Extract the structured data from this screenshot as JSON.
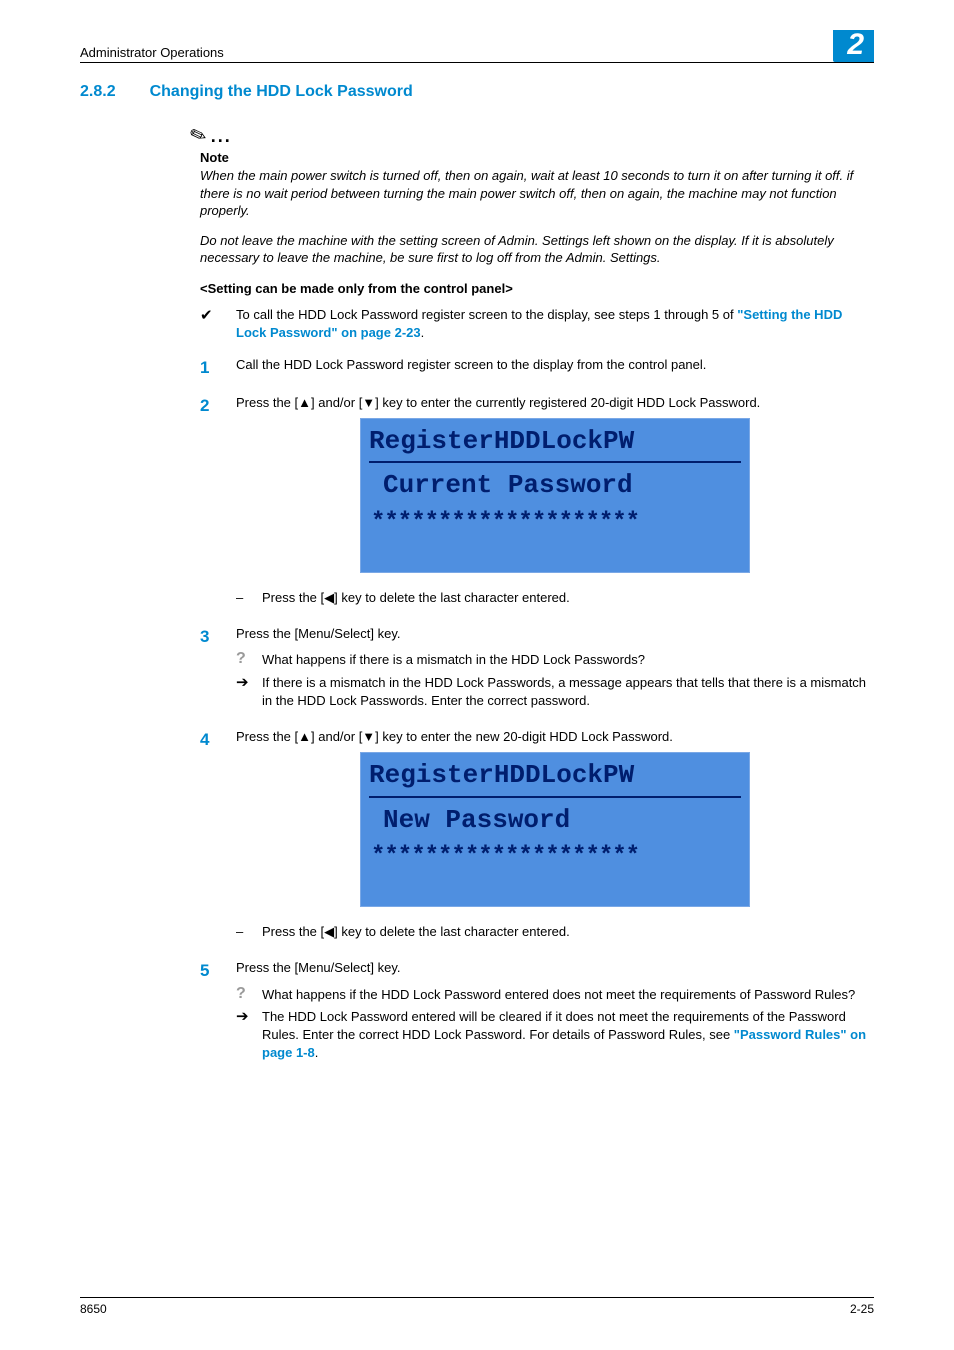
{
  "header": {
    "title": "Administrator Operations",
    "chapter": "2"
  },
  "section": {
    "number": "2.8.2",
    "title": "Changing the HDD Lock Password"
  },
  "note": {
    "label": "Note",
    "para1": "When the main power switch is turned off, then on again, wait at least 10 seconds to turn it on after turning it off. if there is no wait period between turning the main power switch off, then on again, the machine may not function properly.",
    "para2": "Do not leave the machine with the setting screen of Admin. Settings left shown on the display. If it is absolutely necessary to leave the machine, be sure first to log off from the Admin. Settings."
  },
  "subhead": "<Setting can be made only from the control panel>",
  "prereq": {
    "text_before": "To call the HDD Lock Password register screen to the display, see steps 1 through 5 of ",
    "link": "\"Setting the HDD Lock Password\" on page 2-23",
    "text_after": "."
  },
  "steps": {
    "s1": {
      "num": "1",
      "text": "Call the HDD Lock Password register screen to the display from the control panel."
    },
    "s2": {
      "num": "2",
      "text": "Press the [▲] and/or [▼] key to enter the currently registered 20-digit HDD Lock Password.",
      "lcd": {
        "title": "RegisterHDDLockPW",
        "line1": "Current Password",
        "stars": "********************"
      },
      "sub1": "Press the [◀] key to delete the last character entered."
    },
    "s3": {
      "num": "3",
      "text": "Press the [Menu/Select] key.",
      "q": "What happens if there is a mismatch in the HDD Lock Passwords?",
      "a": "If there is a mismatch in the HDD Lock Passwords, a message appears that tells that there is a mismatch in the HDD Lock Passwords. Enter the correct password."
    },
    "s4": {
      "num": "4",
      "text": "Press the [▲] and/or [▼] key to enter the new 20-digit HDD Lock Password.",
      "lcd": {
        "title": "RegisterHDDLockPW",
        "line1": "New Password",
        "stars": "********************"
      },
      "sub1": "Press the [◀] key to delete the last character entered."
    },
    "s5": {
      "num": "5",
      "text": "Press the [Menu/Select] key.",
      "q": "What happens if the HDD Lock Password entered does not meet the requirements of Password Rules?",
      "a_before": "The HDD Lock Password entered will be cleared if it does not meet the requirements of the Password Rules. Enter the correct HDD Lock Password. For details of Password Rules, see ",
      "a_link": "\"Password Rules\" on page 1-8",
      "a_after": "."
    }
  },
  "footer": {
    "left": "8650",
    "right": "2-25"
  }
}
